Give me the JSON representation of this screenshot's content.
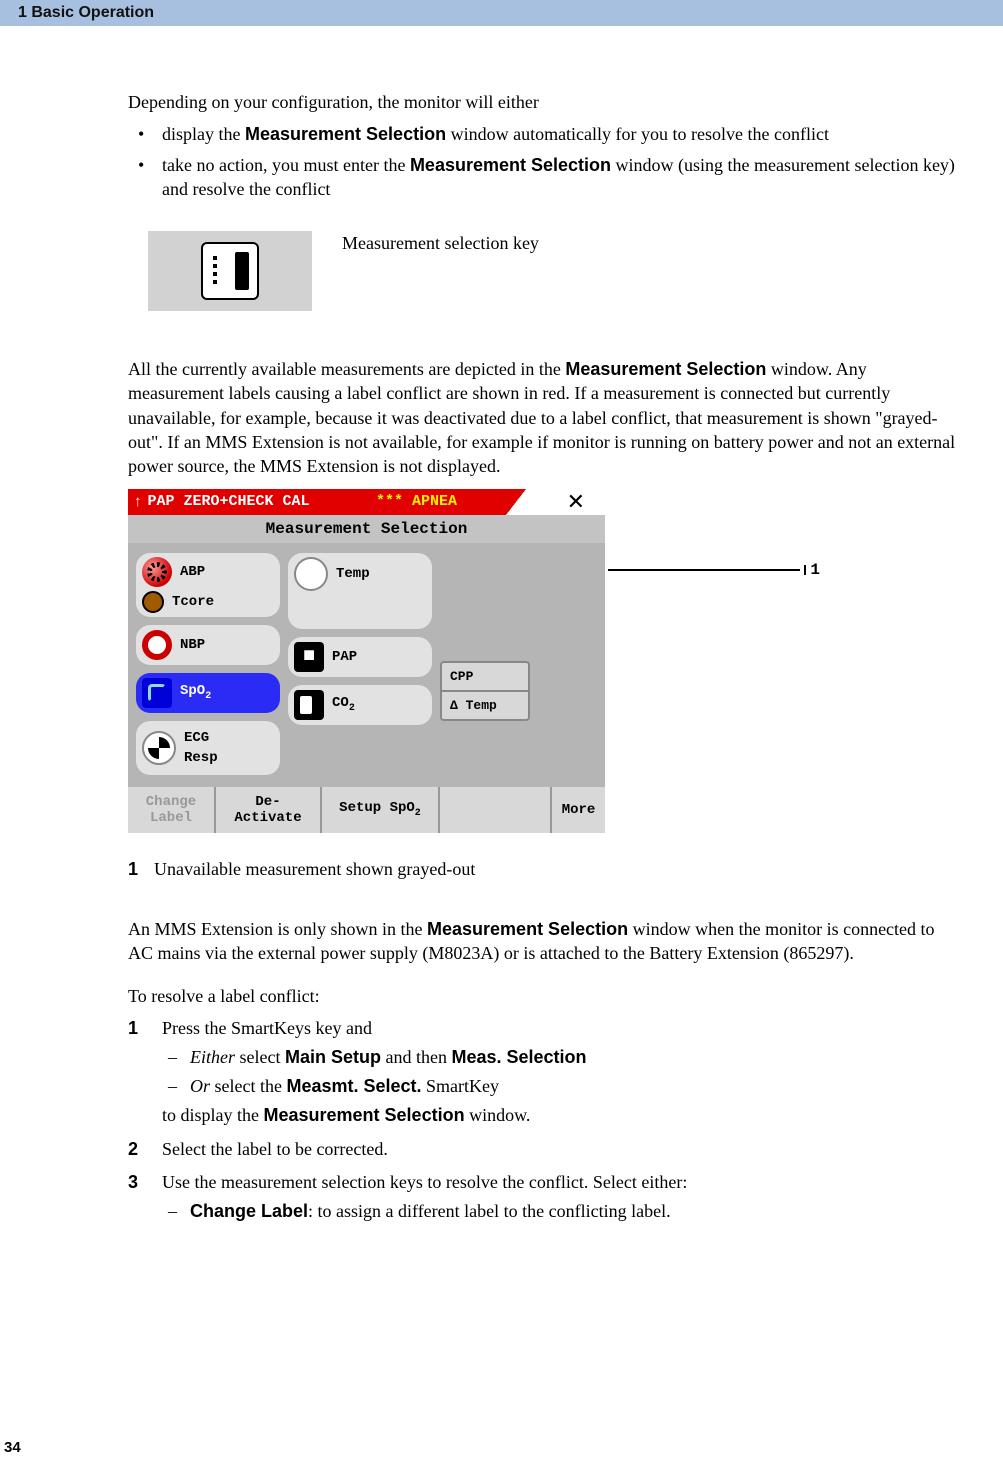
{
  "header": {
    "chapter": "1 Basic Operation"
  },
  "intro": "Depending on your configuration, the monitor will either",
  "bullets": [
    [
      "display the ",
      "Measurement Selection",
      " window automatically for you to resolve the conflict"
    ],
    [
      "take no action, you must enter the ",
      "Measurement Selection",
      " window (using the measurement selection key) and resolve the conflict"
    ]
  ],
  "key_caption": "Measurement selection key",
  "para2": [
    "All the currently available measurements are depicted in the ",
    "Measurement Selection",
    " window. Any measurement labels causing a label conflict are shown in red. If a measurement is connected but currently unavailable, for example, because it was deactivated due to a label conflict, that measurement is shown \"grayed-out\". If an MMS Extension is not available, for example if monitor is running on battery power and not an external power source, the MMS Extension is not displayed."
  ],
  "screenshot": {
    "alert_left": "PAP ZERO+CHECK CAL",
    "alert_mid": "*** APNEA",
    "close_glyph": "✕",
    "title": "Measurement Selection",
    "col1": [
      {
        "labels": [
          "ABP",
          "Tcore"
        ],
        "double": true
      },
      {
        "labels": [
          "NBP"
        ]
      },
      {
        "labels": [
          "SpO",
          "2"
        ],
        "selected": true
      },
      {
        "labels": [
          "ECG",
          "Resp"
        ],
        "double": true
      }
    ],
    "col2": [
      {
        "labels": [
          "Temp"
        ]
      },
      {
        "labels": [
          "PAP"
        ]
      },
      {
        "labels": [
          "CO",
          "2"
        ]
      }
    ],
    "derived": [
      "CPP",
      "Δ Temp"
    ],
    "actions": {
      "change_label": "Change\nLabel",
      "deactivate": "De-\nActivate",
      "setup": [
        "Setup SpO",
        "2"
      ],
      "more": "More"
    },
    "callout": "1"
  },
  "caption": {
    "num": "1",
    "text": "Unavailable measurement shown grayed-out"
  },
  "para3": [
    "An MMS Extension is only shown in the ",
    "Measurement Selection",
    " window when the monitor is connected to AC mains via the external power supply (M8023A) or is attached to the Battery Extension (865297)."
  ],
  "para4": "To resolve a label conflict:",
  "steps": {
    "s1": {
      "num": "1",
      "text": "Press the SmartKeys key and",
      "sub1": [
        "Either",
        " select ",
        "Main Setup",
        " and then ",
        "Meas. Selection"
      ],
      "sub2": [
        "Or",
        " select the ",
        "Measmt. Select.",
        " SmartKey"
      ],
      "tail": [
        "to display the ",
        "Measurement Selection",
        " window."
      ]
    },
    "s2": {
      "num": "2",
      "text": "Select the label to be corrected."
    },
    "s3": {
      "num": "3",
      "text": "Use the measurement selection keys to resolve the conflict. Select either:",
      "sub1": [
        "Change Label",
        ": to assign a different label to the conflicting label."
      ]
    }
  },
  "page_number": "34"
}
